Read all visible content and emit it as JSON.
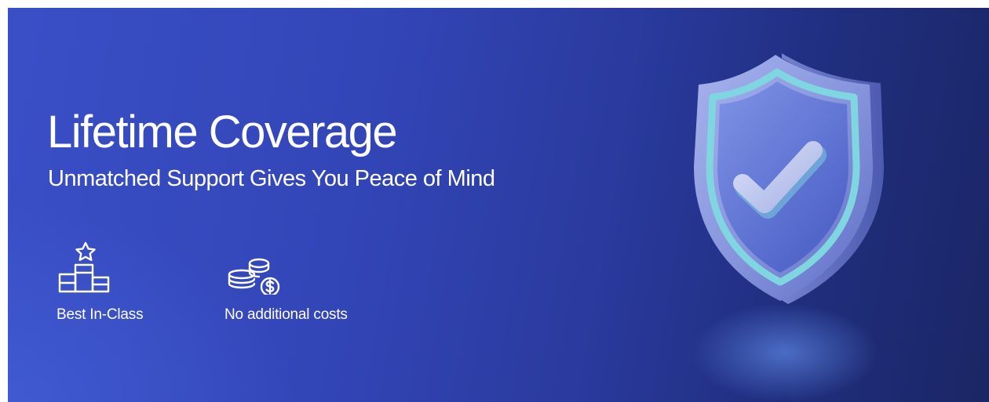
{
  "banner": {
    "title": "Lifetime Coverage",
    "subtitle": "Unmatched Support Gives You Peace of Mind"
  },
  "features": [
    {
      "icon": "podium-star-icon",
      "label": "Best In-Class"
    },
    {
      "icon": "coins-dollar-icon",
      "label": "No additional costs"
    }
  ],
  "illustration": {
    "icon": "shield-check-icon"
  },
  "colors": {
    "background_start": "#3a4fc7",
    "background_end": "#1b2665",
    "text": "#ffffff",
    "shield_teal": "#7fd6e0",
    "shield_body": "#8b9be0"
  }
}
